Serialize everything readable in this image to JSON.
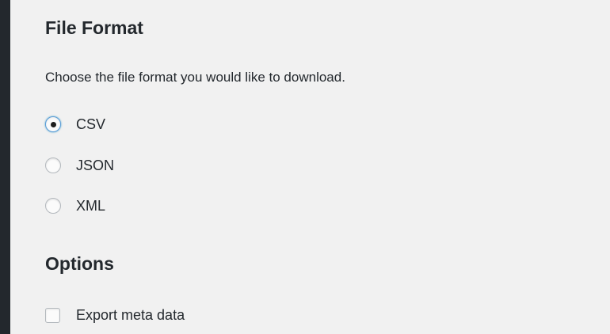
{
  "file_format": {
    "title": "File Format",
    "description": "Choose the file format you would like to download.",
    "options": [
      {
        "label": "CSV",
        "checked": true
      },
      {
        "label": "JSON",
        "checked": false
      },
      {
        "label": "XML",
        "checked": false
      }
    ]
  },
  "options_section": {
    "title": "Options",
    "export_meta": {
      "label": "Export meta data",
      "checked": false
    }
  },
  "colors": {
    "sidebar": "#23282d",
    "background": "#f1f1f1",
    "focus_ring": "#5b9dd9"
  }
}
